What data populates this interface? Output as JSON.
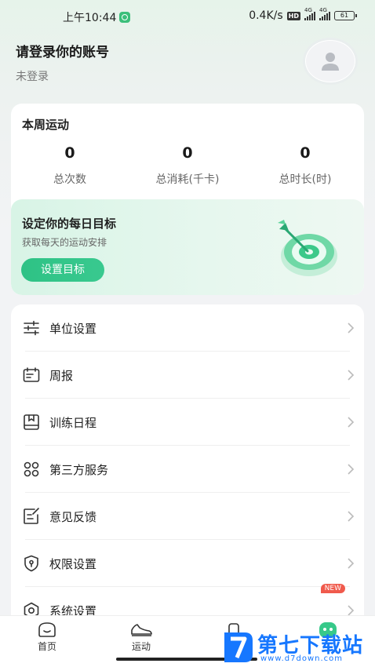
{
  "status_bar": {
    "time": "上午10:44",
    "network_speed": "0.4K/s",
    "hd": "HD",
    "signal1_label": "4G",
    "signal2_label": "4G",
    "battery": "61"
  },
  "profile": {
    "title": "请登录你的账号",
    "subtitle": "未登录"
  },
  "weekly": {
    "title": "本周运动",
    "stats": [
      {
        "value": "0",
        "label": "总次数"
      },
      {
        "value": "0",
        "label": "总消耗(千卡)"
      },
      {
        "value": "0",
        "label": "总时长(时)"
      }
    ]
  },
  "goal": {
    "title": "设定你的每日目标",
    "subtitle": "获取每天的运动安排",
    "button": "设置目标"
  },
  "menu": {
    "items": [
      {
        "label": "单位设置",
        "icon": "sliders-icon"
      },
      {
        "label": "周报",
        "icon": "calendar-icon"
      },
      {
        "label": "训练日程",
        "icon": "schedule-icon"
      },
      {
        "label": "第三方服务",
        "icon": "grid-icon"
      },
      {
        "label": "意见反馈",
        "icon": "feedback-icon"
      },
      {
        "label": "权限设置",
        "icon": "shield-icon"
      },
      {
        "label": "系统设置",
        "icon": "gear-icon"
      }
    ],
    "new_badge": "NEW"
  },
  "nav": {
    "home": "首页",
    "sport": "运动"
  },
  "watermark": {
    "text": "第七下载站",
    "url": "www.d7down.com"
  },
  "colors": {
    "accent": "#2ec285",
    "badge": "#f05a4c",
    "watermark": "#1677ff"
  }
}
